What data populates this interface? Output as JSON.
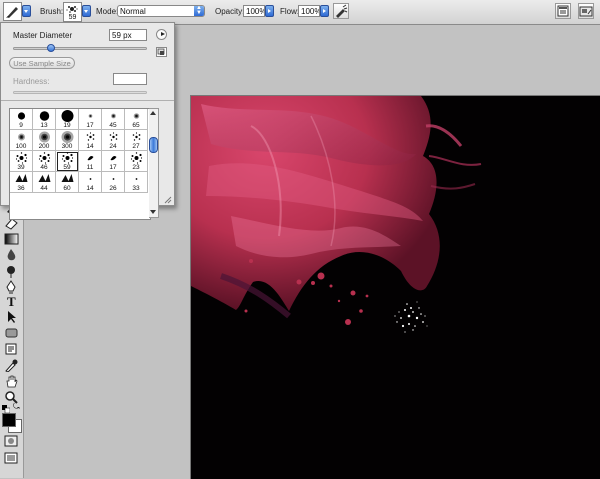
{
  "options_bar": {
    "brush_label": "Brush:",
    "brush_size": "59",
    "mode_label": "Mode:",
    "mode_value": "Normal",
    "opacity_label": "Opacity:",
    "opacity_value": "100%",
    "flow_label": "Flow:",
    "flow_value": "100%"
  },
  "brush_panel": {
    "master_diameter_label": "Master Diameter",
    "master_diameter_value": "59 px",
    "master_diameter_level": 0.28,
    "use_sample_size_label": "Use Sample Size",
    "hardness_label": "Hardness:",
    "hardness_value": "",
    "presets": [
      {
        "size": "9",
        "kind": "hard"
      },
      {
        "size": "13",
        "kind": "hard"
      },
      {
        "size": "19",
        "kind": "hard"
      },
      {
        "size": "17",
        "kind": "soft"
      },
      {
        "size": "45",
        "kind": "soft"
      },
      {
        "size": "65",
        "kind": "soft"
      },
      {
        "size": "100",
        "kind": "soft"
      },
      {
        "size": "200",
        "kind": "soft"
      },
      {
        "size": "300",
        "kind": "soft"
      },
      {
        "size": "14",
        "kind": "scatter"
      },
      {
        "size": "24",
        "kind": "scatter"
      },
      {
        "size": "27",
        "kind": "scatter"
      },
      {
        "size": "39",
        "kind": "splatter"
      },
      {
        "size": "46",
        "kind": "splatter"
      },
      {
        "size": "59",
        "kind": "splatter",
        "selected": true
      },
      {
        "size": "11",
        "kind": "leaf"
      },
      {
        "size": "17",
        "kind": "leaf"
      },
      {
        "size": "23",
        "kind": "splatter"
      },
      {
        "size": "36",
        "kind": "grass"
      },
      {
        "size": "44",
        "kind": "grass"
      },
      {
        "size": "60",
        "kind": "grass"
      },
      {
        "size": "14",
        "kind": "dot"
      },
      {
        "size": "26",
        "kind": "dot"
      },
      {
        "size": "33",
        "kind": "dot"
      }
    ]
  },
  "colors": {
    "accent": "#3a78d8",
    "canvas": "#030102",
    "paint": "#c8385c"
  },
  "icons": {
    "brush_tool": "brush-icon",
    "airbrush": "airbrush-icon",
    "palette_well": "palette-well-icon",
    "panel_menu": "flyout-arrow-icon",
    "new_preset": "new-preset-icon"
  }
}
